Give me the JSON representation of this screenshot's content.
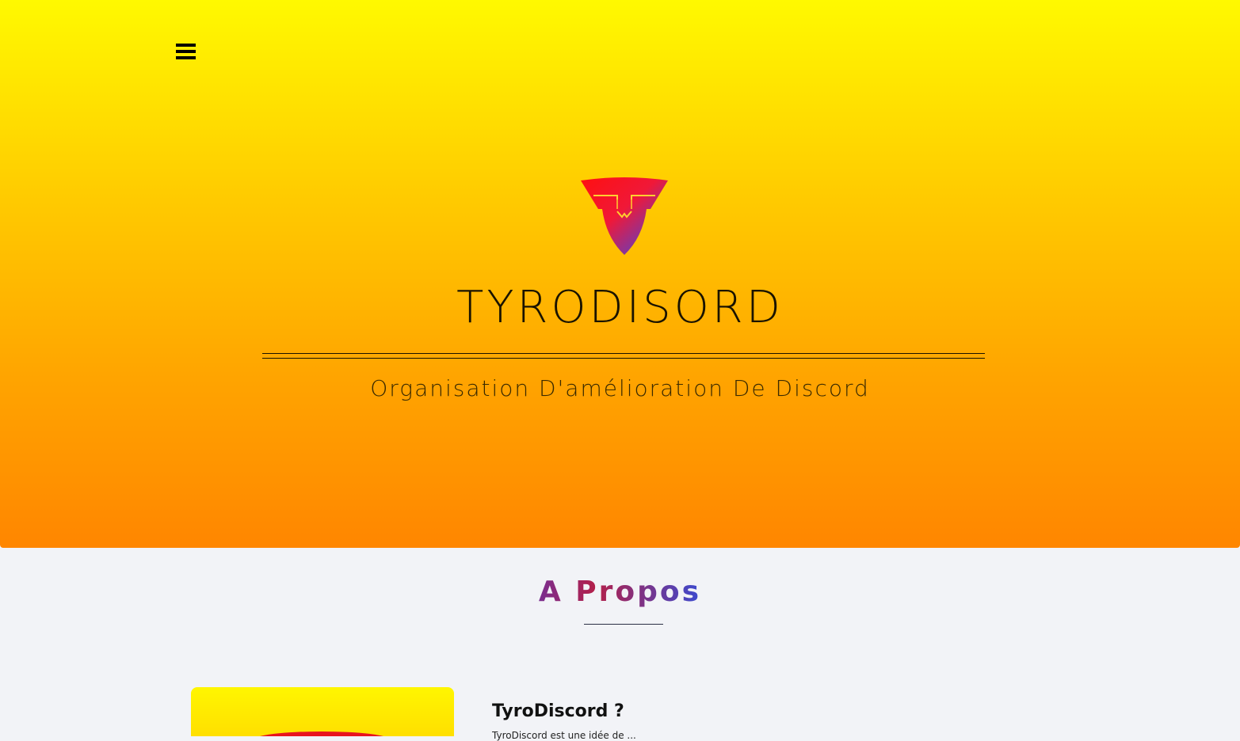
{
  "hero": {
    "menu_icon": "hamburger-menu-icon",
    "logo_icon": "tyrodiscord-shield-logo",
    "title": "TYRODISORD",
    "subtitle": "Organisation D'amélioration De Discord",
    "gradient_top": "#fff900",
    "gradient_bottom": "#ff8600"
  },
  "about": {
    "title": "A Propos",
    "card_heading": "TyroDiscord ?",
    "card_text": "TyroDiscord est une idée de ..."
  },
  "colors": {
    "logo_red": "#f01818",
    "logo_blue": "#3b47e8",
    "accent_purple": "#7a2d8f",
    "page_background": "#f2f3f7"
  }
}
